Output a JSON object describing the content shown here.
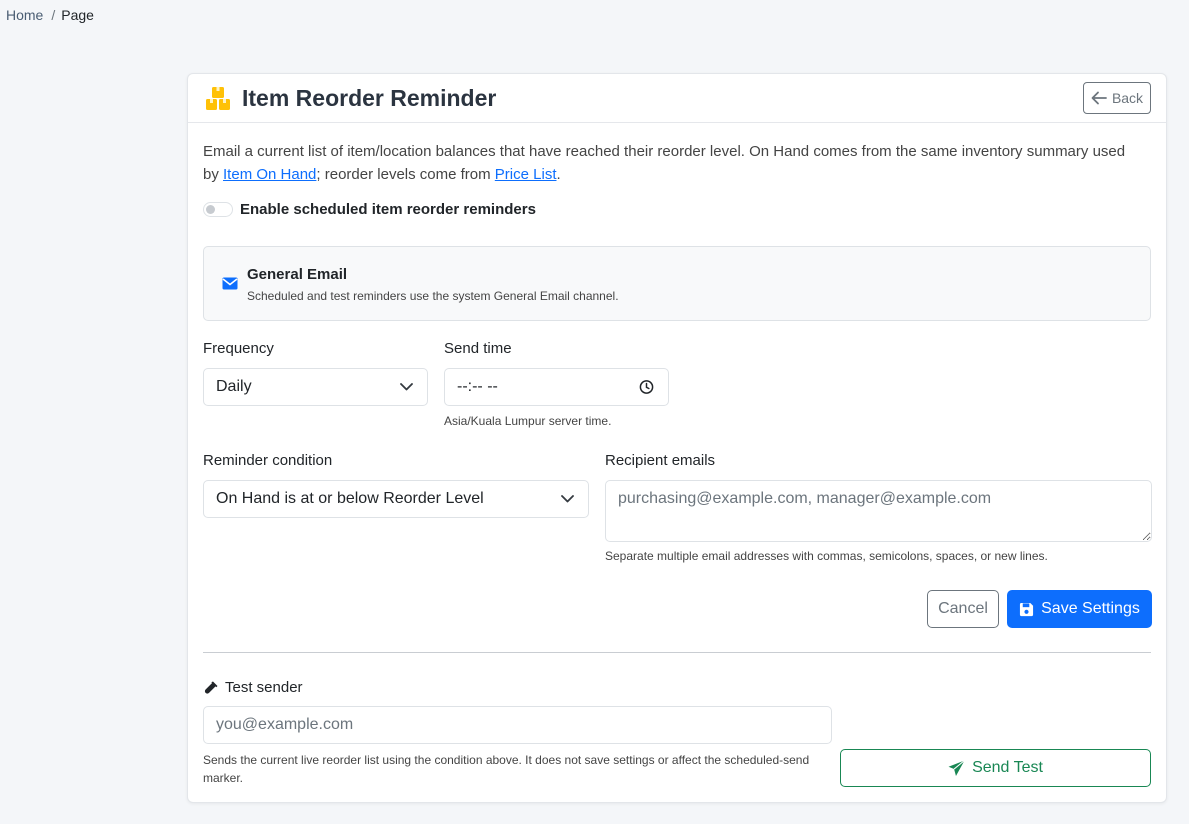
{
  "breadcrumb": {
    "home": "Home",
    "separator": "/",
    "current": "Page"
  },
  "header": {
    "title": "Item Reorder Reminder",
    "back_label": "Back",
    "title_icon": "boxes-icon",
    "icon_color": "#ffc107"
  },
  "intro": {
    "text_before": "Email a current list of item/location balances that have reached their reorder level. On Hand comes from the same inventory summary used by ",
    "link1": "Item On Hand",
    "text_middle": "; reorder levels come from ",
    "link2": "Price List",
    "text_after": "."
  },
  "schedule_toggle": {
    "label": "Enable scheduled item reorder reminders",
    "enabled": false
  },
  "email_channel": {
    "title": "General Email",
    "description": "Scheduled and test reminders use the system General Email channel.",
    "icon": "envelope-icon"
  },
  "frequency": {
    "label": "Frequency",
    "value": "Daily"
  },
  "send_time": {
    "label": "Send time",
    "value": "--:-- --",
    "help": "Asia/Kuala Lumpur server time."
  },
  "condition": {
    "label": "Reminder condition",
    "value": "On Hand is at or below Reorder Level"
  },
  "recipients": {
    "label": "Recipient emails",
    "placeholder": "purchasing@example.com, manager@example.com",
    "help": "Separate multiple email addresses with commas, semicolons, spaces, or new lines."
  },
  "actions": {
    "cancel": "Cancel",
    "save": "Save Settings"
  },
  "test": {
    "label": "Test sender",
    "placeholder": "you@example.com",
    "help": "Sends the current live reorder list using the condition above. It does not save settings or affect the scheduled-send marker.",
    "send": "Send Test"
  },
  "colors": {
    "primary": "#0d6efd",
    "success": "#198754",
    "secondary": "#6c757d",
    "warning": "#ffc107"
  }
}
